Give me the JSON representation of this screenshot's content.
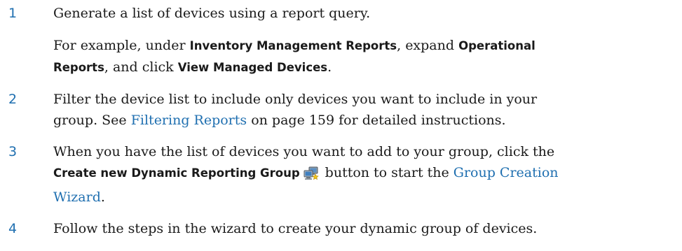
{
  "steps": [
    {
      "number": "1",
      "text": "Generate a list of devices using a report query.",
      "note": {
        "t1": "For example, under ",
        "b1": "Inventory Management Reports",
        "t2": ", expand ",
        "b2": "Operational",
        "b3": "Reports",
        "t3": ", and click ",
        "b4": "View Managed Devices",
        "t4": "."
      }
    },
    {
      "number": "2",
      "t1": "Filter the device list to include only devices you want to include in your",
      "t2": "group. See ",
      "link": "Filtering Reports",
      "t3": " on page 159 for detailed instructions."
    },
    {
      "number": "3",
      "t1": "When you have the list of devices you want to add to your group, click the",
      "b1": "Create new Dynamic Reporting Group",
      "icon": "dynamic-group-computers-icon",
      "t2": " button to start the ",
      "link1": "Group Creation",
      "link2": "Wizard",
      "t3": "."
    },
    {
      "number": "4",
      "text": "Follow the steps in the wizard to create your dynamic group of devices."
    }
  ],
  "colors": {
    "link": "#1f6fb0",
    "text": "#1a1a1a"
  }
}
